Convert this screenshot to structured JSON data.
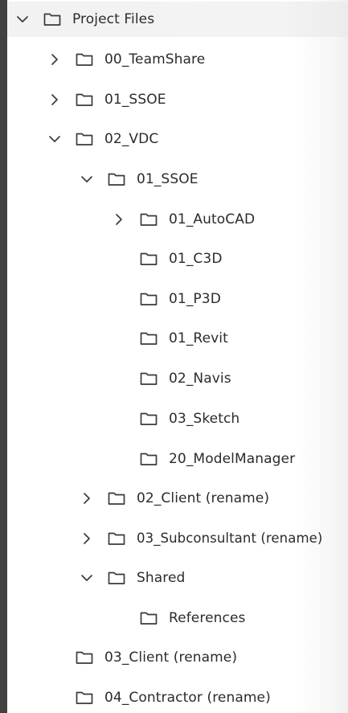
{
  "tree": {
    "root": {
      "label": "Project Files",
      "state": "expanded"
    },
    "items": [
      {
        "label": "00_TeamShare",
        "state": "collapsed"
      },
      {
        "label": "01_SSOE",
        "state": "collapsed"
      },
      {
        "label": "02_VDC",
        "state": "expanded"
      },
      {
        "label": "01_SSOE",
        "state": "expanded"
      },
      {
        "label": "01_AutoCAD",
        "state": "collapsed"
      },
      {
        "label": "01_C3D",
        "state": "leaf"
      },
      {
        "label": "01_P3D",
        "state": "leaf"
      },
      {
        "label": "01_Revit",
        "state": "leaf"
      },
      {
        "label": "02_Navis",
        "state": "leaf"
      },
      {
        "label": "03_Sketch",
        "state": "leaf"
      },
      {
        "label": "20_ModelManager",
        "state": "leaf"
      },
      {
        "label": "02_Client (rename)",
        "state": "collapsed"
      },
      {
        "label": "03_Subconsultant (rename)",
        "state": "collapsed"
      },
      {
        "label": "Shared",
        "state": "expanded"
      },
      {
        "label": "References",
        "state": "leaf"
      },
      {
        "label": "03_Client (rename)",
        "state": "leaf"
      },
      {
        "label": "04_Contractor (rename)",
        "state": "leaf"
      }
    ]
  },
  "icons": {
    "expanded": "chevron-down-icon",
    "collapsed": "chevron-right-icon",
    "folder": "folder-icon"
  },
  "colors": {
    "panel_bg": "#ffffff",
    "hover_bg": "#f2f2f2",
    "frame_bg": "#3c3c3c",
    "text": "#2b2b2b"
  }
}
